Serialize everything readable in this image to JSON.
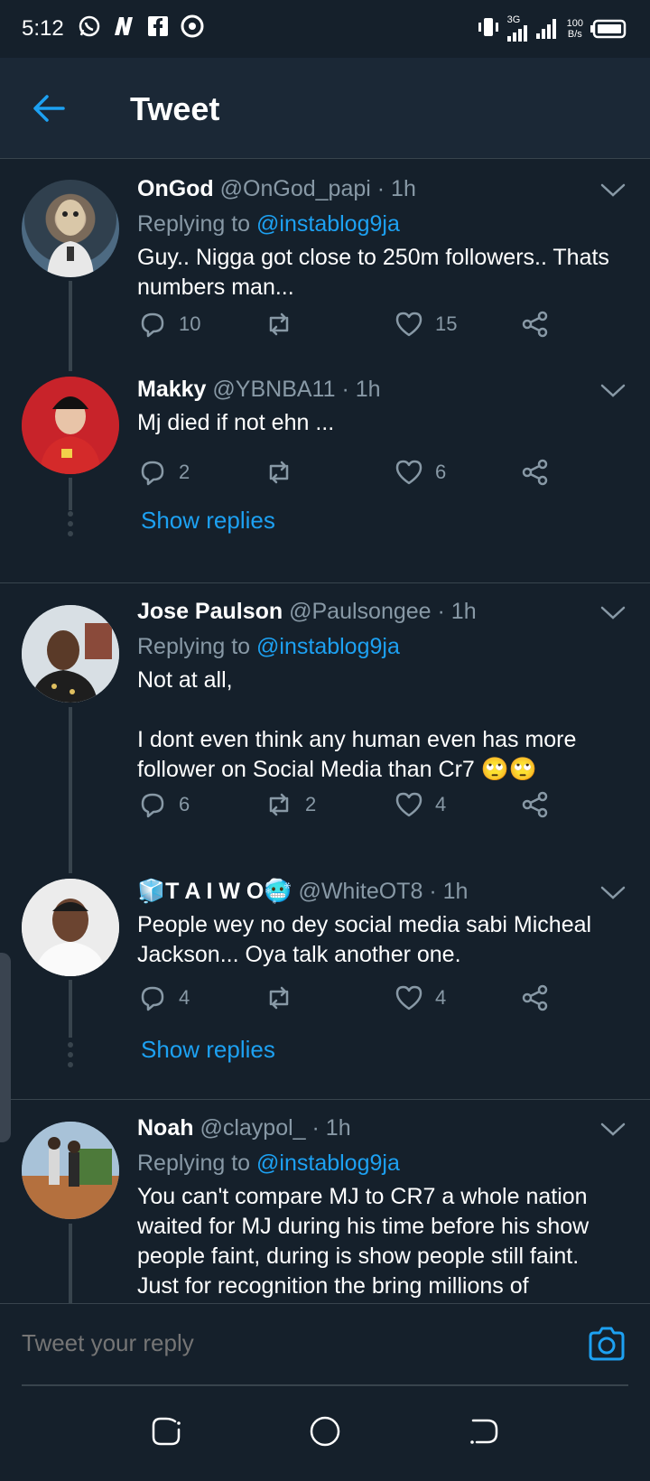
{
  "status_bar": {
    "time": "5:12",
    "network": "3G",
    "speed_value": "100",
    "speed_unit": "B/s"
  },
  "header": {
    "title": "Tweet"
  },
  "colors": {
    "background": "#15202b",
    "header": "#1b2836",
    "accent": "#1da1f2",
    "muted": "#8899a6",
    "divider": "#38444d"
  },
  "tweets": [
    {
      "name": "OnGod",
      "handle": "@OnGod_papi",
      "time": "· 1h",
      "replying_prefix": "Replying to",
      "replying_to": "@instablog9ja",
      "text": "Guy.. Nigga got close to 250m followers.. Thats numbers man...",
      "replies": "10",
      "retweets": "",
      "likes": "15"
    },
    {
      "name": "Makky",
      "handle": "@YBNBA11",
      "time": "· 1h",
      "text": "Mj died if not ehn ...",
      "replies": "2",
      "retweets": "",
      "likes": "6",
      "show_replies": "Show replies"
    },
    {
      "name": "Jose Paulson",
      "handle": "@Paulsongee",
      "time": "· 1h",
      "replying_prefix": "Replying to",
      "replying_to": "@instablog9ja",
      "text": "Not at all,\n\nI dont even think any human even has more follower on Social Media than Cr7 🙄🙄",
      "replies": "6",
      "retweets": "2",
      "likes": "4"
    },
    {
      "name": "🧊T A I W O🥶",
      "handle": "@WhiteOT8",
      "time": "· 1h",
      "text": "People wey no dey social media sabi Micheal Jackson... Oya talk another one.",
      "replies": "4",
      "retweets": "",
      "likes": "4",
      "show_replies": "Show replies"
    },
    {
      "name": "Noah",
      "handle": "@claypol_",
      "time": "· 1h",
      "replying_prefix": "Replying to",
      "replying_to": "@instablog9ja",
      "text": "You can't compare MJ to CR7 a whole nation waited for MJ during his time before his show people faint, during is show people still faint. Just for recognition the bring millions of soldiers."
    }
  ],
  "reply_bar": {
    "placeholder": "Tweet your reply"
  }
}
